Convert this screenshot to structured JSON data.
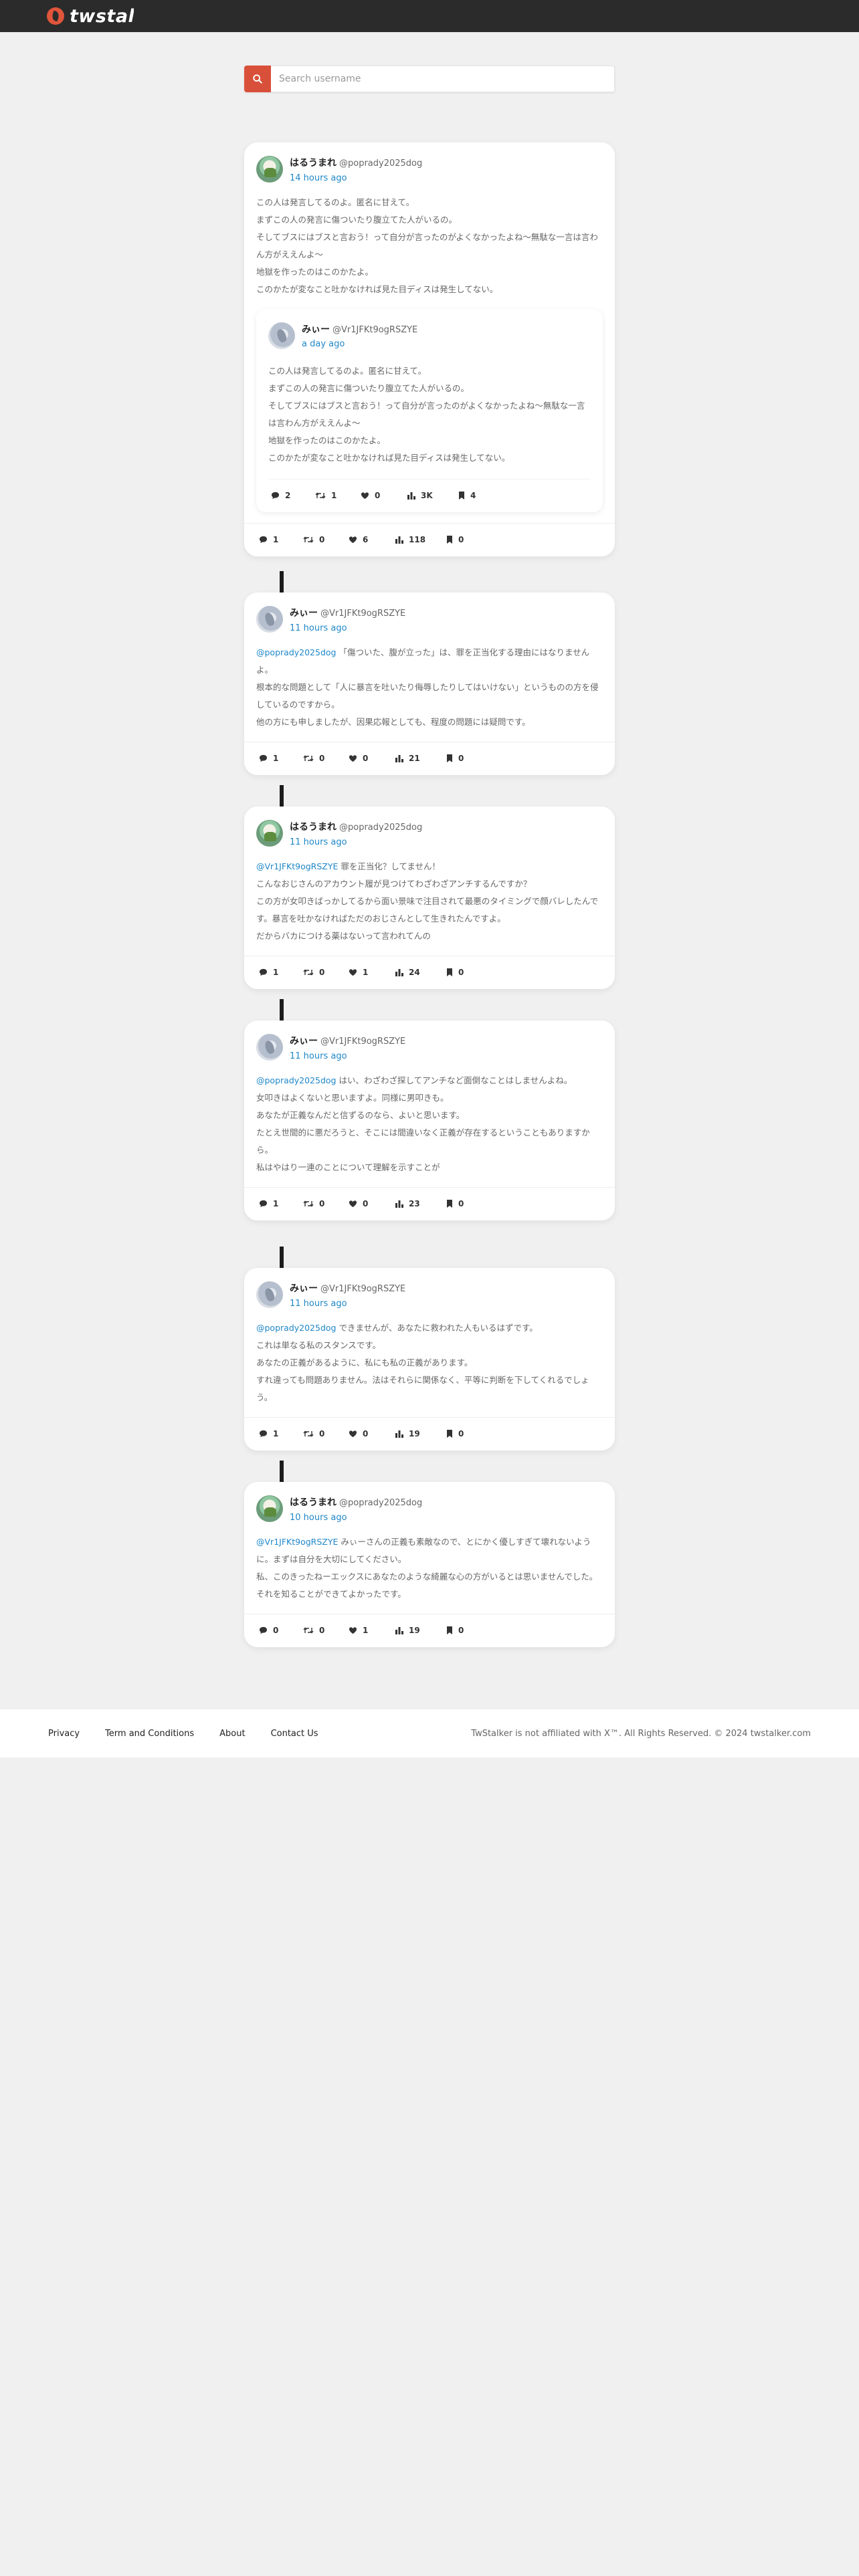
{
  "header": {
    "logo_text": "twstalker"
  },
  "search": {
    "placeholder": "Search username"
  },
  "posts": [
    {
      "name": "はるうまれ",
      "handle": "@poprady2025dog",
      "time": "14 hours ago",
      "mention": "",
      "text": "この人は発言してるのよ。匿名に甘えて。\nまずこの人の発言に傷ついたり腹立てた人がいるの。\nそしてブスにはブスと言おう！って自分が言ったのがよくなかったよね〜無駄な一言は言わん方がええんよ〜\n地獄を作ったのはこのかたよ。\nこのかたが変なこと吐かなければ見た目ディスは発生してない。",
      "quote": {
        "name": "みぃー",
        "handle": "@Vr1JFKt9ogRSZYE",
        "time": "a day ago",
        "text": "この人は発言してるのよ。匿名に甘えて。\nまずこの人の発言に傷ついたり腹立てた人がいるの。\nそしてブスにはブスと言おう！って自分が言ったのがよくなかったよね〜無駄な一言は言わん方がええんよ〜\n地獄を作ったのはこのかたよ。\nこのかたが変なこと吐かなければ見た目ディスは発生してない。",
        "stats": {
          "replies": "2",
          "retweets": "1",
          "likes": "0",
          "views": "3K",
          "bookmarks": "4"
        }
      },
      "stats": {
        "replies": "1",
        "retweets": "0",
        "likes": "6",
        "views": "118",
        "bookmarks": "0"
      }
    },
    {
      "name": "みぃー",
      "handle": "@Vr1JFKt9ogRSZYE",
      "time": "11 hours ago",
      "mention": "@poprady2025dog",
      "text": " 「傷ついた、腹が立った」は、罪を正当化する理由にはなりませんよ。\n根本的な問題として「人に暴言を吐いたり侮辱したりしてはいけない」というものの方を侵しているのですから。\n他の方にも申しましたが、因果応報としても、程度の問題には疑問です。",
      "stats": {
        "replies": "1",
        "retweets": "0",
        "likes": "0",
        "views": "21",
        "bookmarks": "0"
      }
    },
    {
      "name": "はるうまれ",
      "handle": "@poprady2025dog",
      "time": "11 hours ago",
      "mention": "@Vr1JFKt9ogRSZYE",
      "text": " 罪を正当化？してません！\nこんなおじさんのアカウント履が見つけてわざわざアンチするんですか？\nこの方が女叩きばっかしてるから面い景味で注目されて最悪のタイミングで顔バレしたんです。暴言を吐かなければただのおじさんとして生きれたんですよ。\nだからバカにつける薬はないって言われてんの",
      "stats": {
        "replies": "1",
        "retweets": "0",
        "likes": "1",
        "views": "24",
        "bookmarks": "0"
      }
    },
    {
      "name": "みぃー",
      "handle": "@Vr1JFKt9ogRSZYE",
      "time": "11 hours ago",
      "mention": "@poprady2025dog",
      "text": " はい、わざわざ探してアンチなど面倒なことはしませんよね。\n女叩きはよくないと思いますよ。同様に男叩きも。\nあなたが正義なんだと信ずるのなら、よいと思います。\nたとえ世間的に悪だろうと、そこには間違いなく正義が存在するということもありますから。\n私はやはり一連のことについて理解を示すことが",
      "stats": {
        "replies": "1",
        "retweets": "0",
        "likes": "0",
        "views": "23",
        "bookmarks": "0"
      }
    },
    {
      "name": "みぃー",
      "handle": "@Vr1JFKt9ogRSZYE",
      "time": "11 hours ago",
      "mention": "@poprady2025dog",
      "text": " できませんが、あなたに救われた人もいるはずです。\nこれは単なる私のスタンスです。\nあなたの正義があるように、私にも私の正義があります。\nすれ違っても問題ありません。法はそれらに関係なく、平等に判断を下してくれるでしょう。",
      "stats": {
        "replies": "1",
        "retweets": "0",
        "likes": "0",
        "views": "19",
        "bookmarks": "0"
      }
    },
    {
      "name": "はるうまれ",
      "handle": "@poprady2025dog",
      "time": "10 hours ago",
      "mention": "@Vr1JFKt9ogRSZYE",
      "text": " みぃーさんの正義も素敵なので、とにかく優しすぎて壊れないように。まずは自分を大切にしてください。\n私、このきったねーエックスにあなたのような綺麗な心の方がいるとは思いませんでした。\nそれを知ることができてよかったです。",
      "stats": {
        "replies": "0",
        "retweets": "0",
        "likes": "1",
        "views": "19",
        "bookmarks": "0"
      }
    }
  ],
  "footer": {
    "links": [
      "Privacy",
      "Term and Conditions",
      "About",
      "Contact Us"
    ],
    "copyright": "TwStalker is not affiliated with X™. All Rights Reserved. © 2024 twstalker.com"
  },
  "colors": {
    "accent": "#1f87c8",
    "brand": "#d9503a",
    "topbar": "#2b2b2b"
  }
}
